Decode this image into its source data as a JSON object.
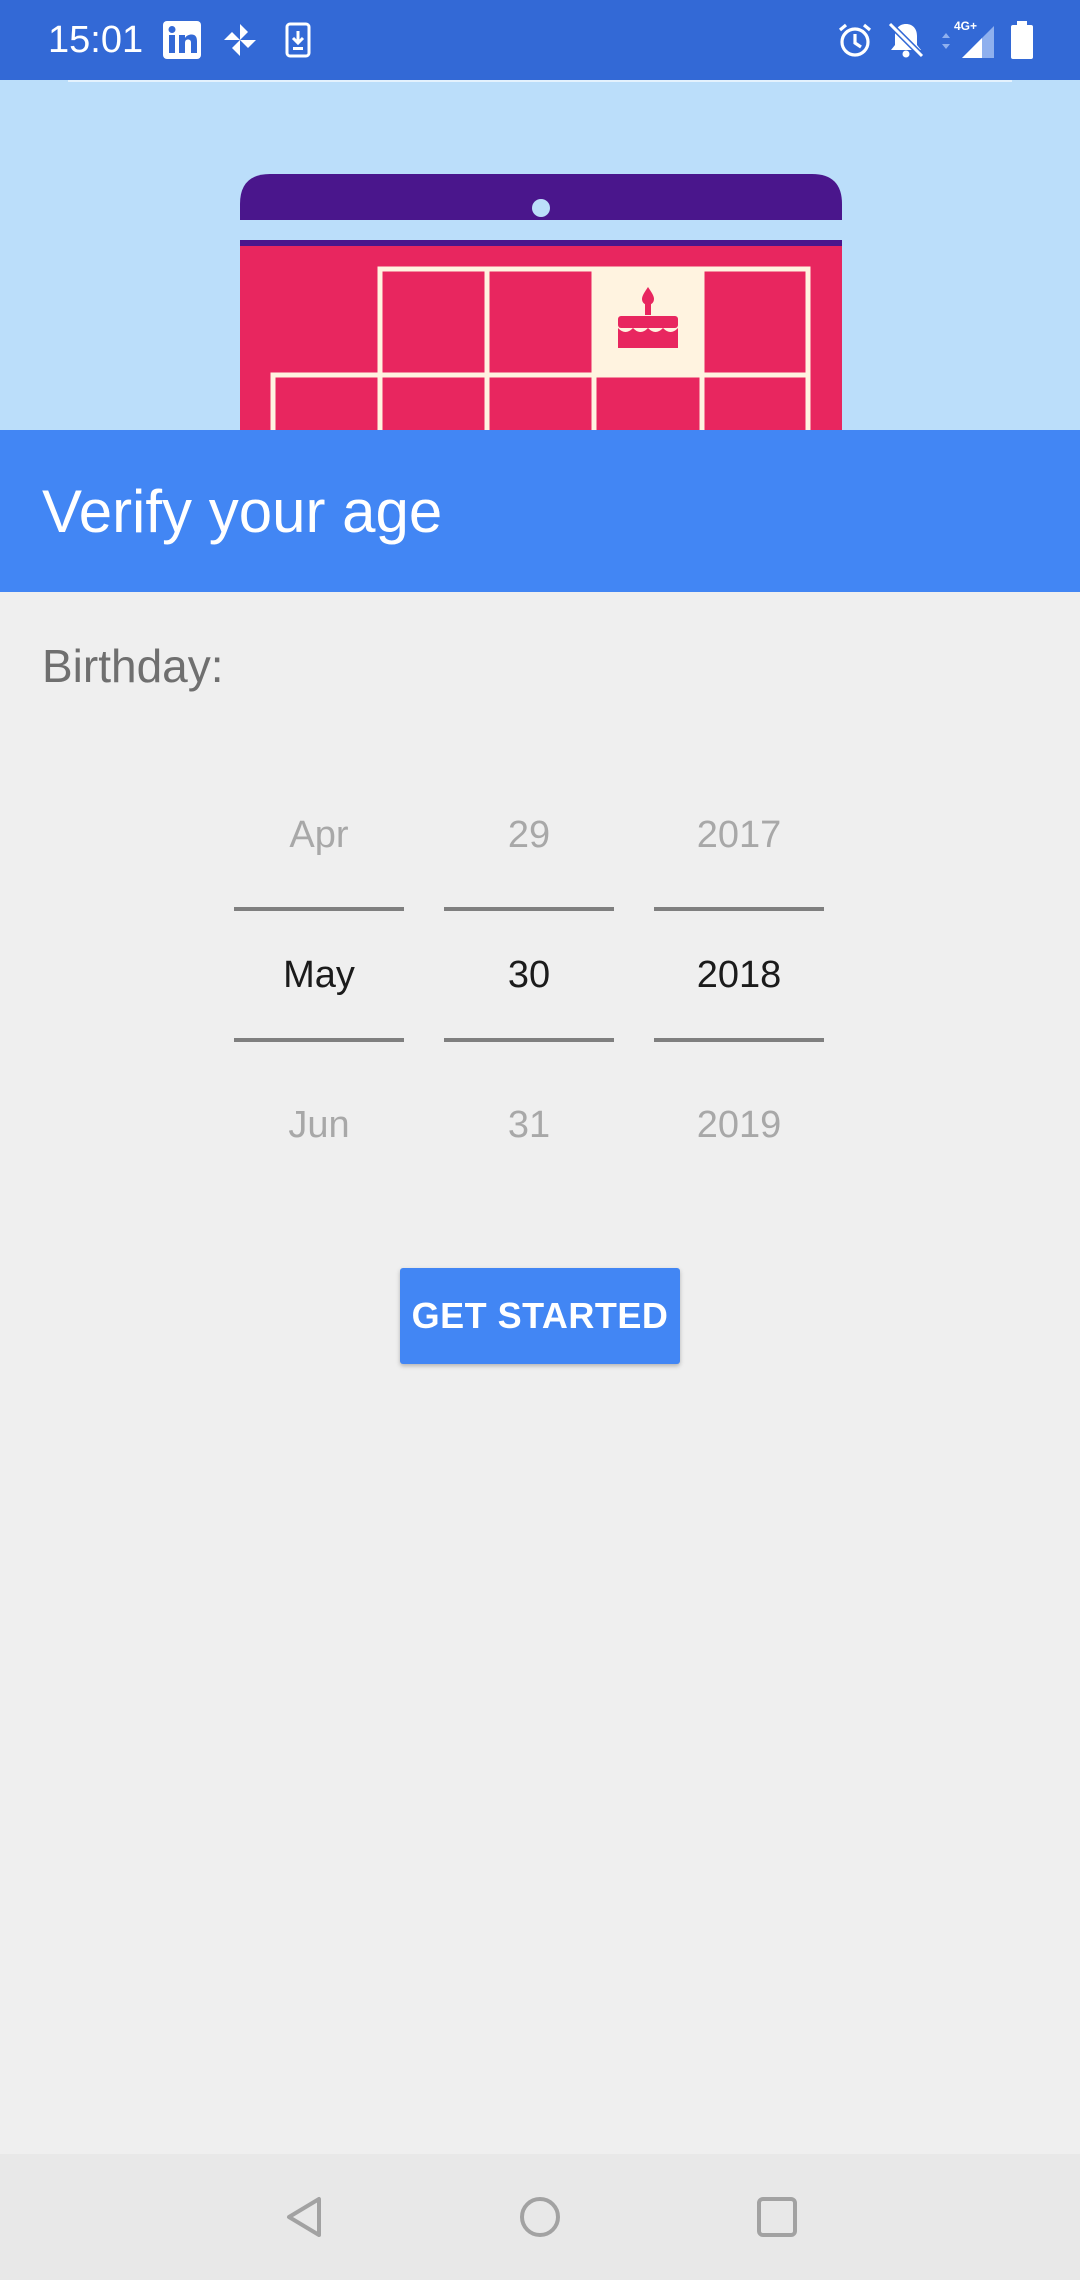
{
  "status_bar": {
    "time": "15:01",
    "network_label": "4G+",
    "left_icons": [
      "linkedin-icon",
      "pinwheel-icon",
      "download-icon"
    ],
    "right_icons": [
      "alarm-icon",
      "notifications-off-icon",
      "signal-icon",
      "battery-icon"
    ]
  },
  "header": {
    "title": "Verify your age"
  },
  "form": {
    "birthday_label": "Birthday:",
    "month": {
      "prev": "Apr",
      "selected": "May",
      "next": "Jun"
    },
    "day": {
      "prev": "29",
      "selected": "30",
      "next": "31"
    },
    "year": {
      "prev": "2017",
      "selected": "2018",
      "next": "2019"
    },
    "submit_label": "GET STARTED"
  },
  "colors": {
    "status_bar": "#3369d6",
    "hero_bg": "#bbdefa",
    "calendar_top": "#4a168c",
    "calendar_body": "#e8265f",
    "calendar_grid": "#fff3e0",
    "accent": "#4286f4"
  }
}
